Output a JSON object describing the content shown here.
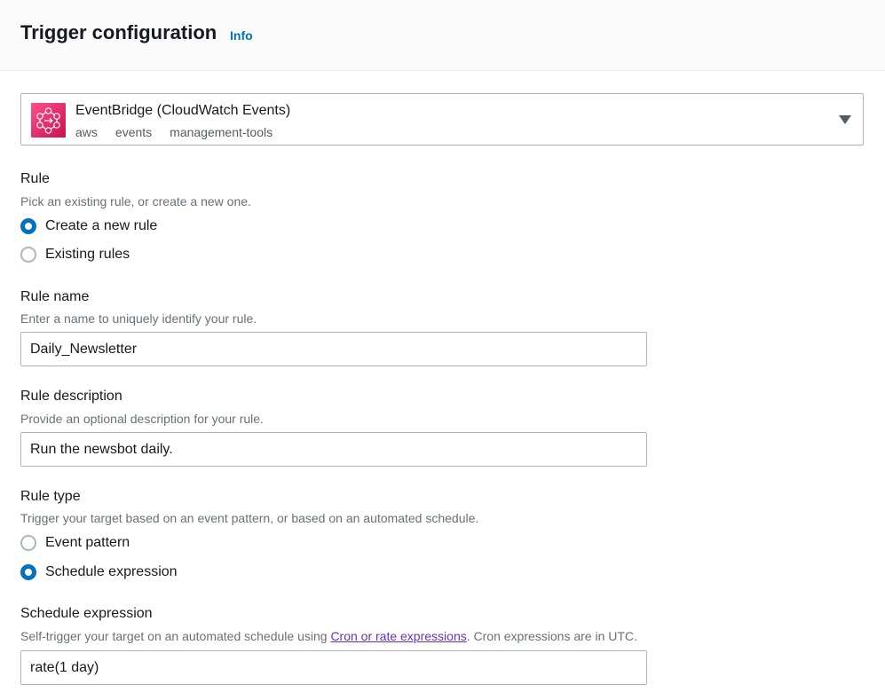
{
  "header": {
    "title": "Trigger configuration",
    "info_link": "Info"
  },
  "trigger_select": {
    "logo_icon": "eventbridge-icon",
    "name": "EventBridge (CloudWatch Events)",
    "tags": [
      "aws",
      "events",
      "management-tools"
    ]
  },
  "rule": {
    "label": "Rule",
    "description": "Pick an existing rule, or create a new one.",
    "options": [
      {
        "label": "Create a new rule",
        "checked": true
      },
      {
        "label": "Existing rules",
        "checked": false
      }
    ]
  },
  "rule_name": {
    "label": "Rule name",
    "description": "Enter a name to uniquely identify your rule.",
    "value": "Daily_Newsletter"
  },
  "rule_description": {
    "label": "Rule description",
    "description": "Provide an optional description for your rule.",
    "value": "Run the newsbot daily."
  },
  "rule_type": {
    "label": "Rule type",
    "description": "Trigger your target based on an event pattern, or based on an automated schedule.",
    "options": [
      {
        "label": "Event pattern",
        "checked": false
      },
      {
        "label": "Schedule expression",
        "checked": true
      }
    ]
  },
  "schedule_expression": {
    "label": "Schedule expression",
    "description_prefix": "Self-trigger your target on an automated schedule using ",
    "description_link": "Cron or rate expressions",
    "description_suffix": ". Cron expressions are in UTC.",
    "value": "rate(1 day)"
  },
  "colors": {
    "accent": "#0073bb",
    "link_visited": "#6b2fba",
    "logo": "#e7157b"
  }
}
